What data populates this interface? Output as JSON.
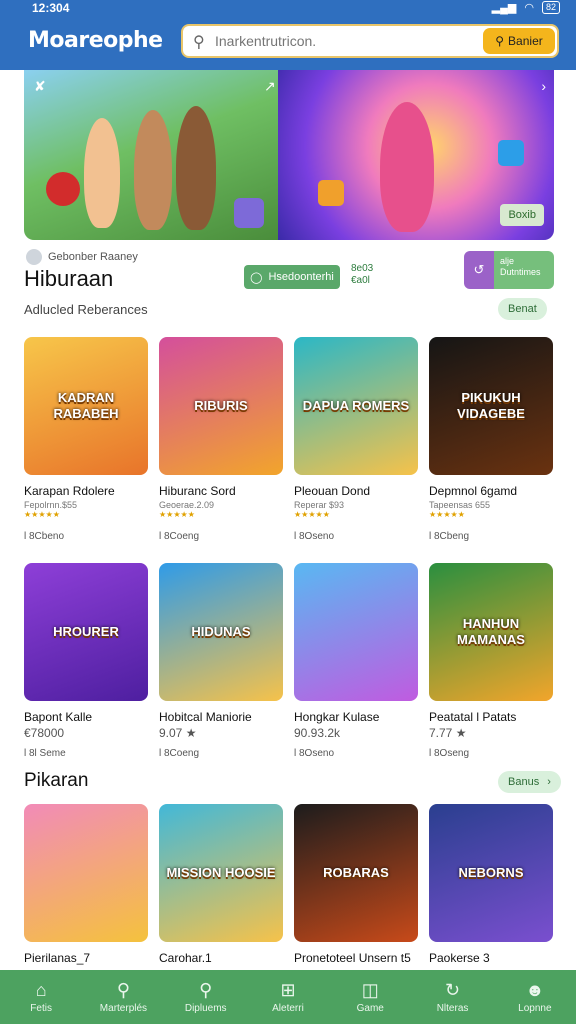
{
  "status": {
    "time": "12:304",
    "battery": "82"
  },
  "header": {
    "logo": "Moareophe",
    "search_placeholder": "Inarkentrutricon.",
    "search_button": "Banier"
  },
  "banner": {
    "tag": "Boxib"
  },
  "section1": {
    "meta": "Gebonber Raaney",
    "title": "Hiburaan",
    "subtitle": "Adlucled Reberances",
    "chip_label": "Hsedoonterhi",
    "mini_stat_top": "8e03",
    "mini_stat_bottom": "€a0l",
    "purple_top": "alje",
    "purple_bottom": "Dutntimes",
    "more_label": "Benat"
  },
  "row1": [
    {
      "art": "KADRAN RABABEH",
      "title": "Karapan Rdolere",
      "sub": "Fepolrnn.$55",
      "stars": "★★★★★",
      "plays": "l 8Cbeno",
      "colors": [
        "#f7c64a",
        "#e8742a"
      ]
    },
    {
      "art": "RIBURIS",
      "title": "Hiburanc Sord",
      "sub": "Geoerae.2.09",
      "stars": "★★★★★",
      "plays": "l 8Coeng",
      "colors": [
        "#d44f9c",
        "#f2a52b"
      ]
    },
    {
      "art": "DAPUA ROMERS",
      "title": "Pleouan Dond",
      "sub": "Reperar $93",
      "stars": "★★★★★",
      "plays": "l 8Oseno",
      "colors": [
        "#2bb7c6",
        "#f6c24a"
      ]
    },
    {
      "art": "PIKUKUH VIDAGEBE",
      "title": "Depmnol 6gamd",
      "sub": "Tapeensas 655",
      "stars": "★★★★★",
      "plays": "l 8Cbeng",
      "colors": [
        "#151515",
        "#6a3210"
      ]
    }
  ],
  "row2": [
    {
      "art": "HROURER",
      "title": "Bapont Kalle",
      "price": "€78000",
      "plays": "l 8l Seme",
      "colors": [
        "#8e3fd8",
        "#4e1fa0"
      ]
    },
    {
      "art": "HIDUNAS",
      "title": "Hobitcal Maniorie",
      "price": "9.07 ★",
      "plays": "l 8Coeng",
      "colors": [
        "#2f9be8",
        "#f6c24a"
      ]
    },
    {
      "art": "",
      "title": "Hongkar Kulase",
      "price": "90.93.2k",
      "plays": "l 8Oseno",
      "colors": [
        "#59b8f2",
        "#c05be0"
      ]
    },
    {
      "art": "HANHUN MAMANAS",
      "title": "Peatatal l Patats",
      "price": "7.77 ★",
      "plays": "l 8Oseng",
      "colors": [
        "#2a8f3f",
        "#f2a52b"
      ]
    }
  ],
  "section2": {
    "title": "Pikaran",
    "more_label": "Banus"
  },
  "row3": [
    {
      "art": "",
      "title": "Pierilanas_7",
      "colors": [
        "#f28bb8",
        "#f4c23d"
      ]
    },
    {
      "art": "MISSION HOOSIE",
      "title": "Carohar.1",
      "colors": [
        "#42b8d8",
        "#f6c24a"
      ]
    },
    {
      "art": "ROBARAS",
      "title": "Pronetoteel Unsern t5",
      "colors": [
        "#1c1c1c",
        "#c84a1a"
      ]
    },
    {
      "art": "NEBORNS",
      "title": "Paokerse 3",
      "colors": [
        "#2a3f8f",
        "#7a4fcf"
      ]
    }
  ],
  "nav": [
    {
      "label": "Fetis",
      "icon": "home-icon"
    },
    {
      "label": "Marterplés",
      "icon": "search-icon"
    },
    {
      "label": "Dipluems",
      "icon": "search-icon"
    },
    {
      "label": "Aleterri",
      "icon": "grid-icon"
    },
    {
      "label": "Game",
      "icon": "gamepad-icon"
    },
    {
      "label": "Nlteras",
      "icon": "refresh-icon"
    },
    {
      "label": "Lopnne",
      "icon": "user-icon"
    }
  ]
}
